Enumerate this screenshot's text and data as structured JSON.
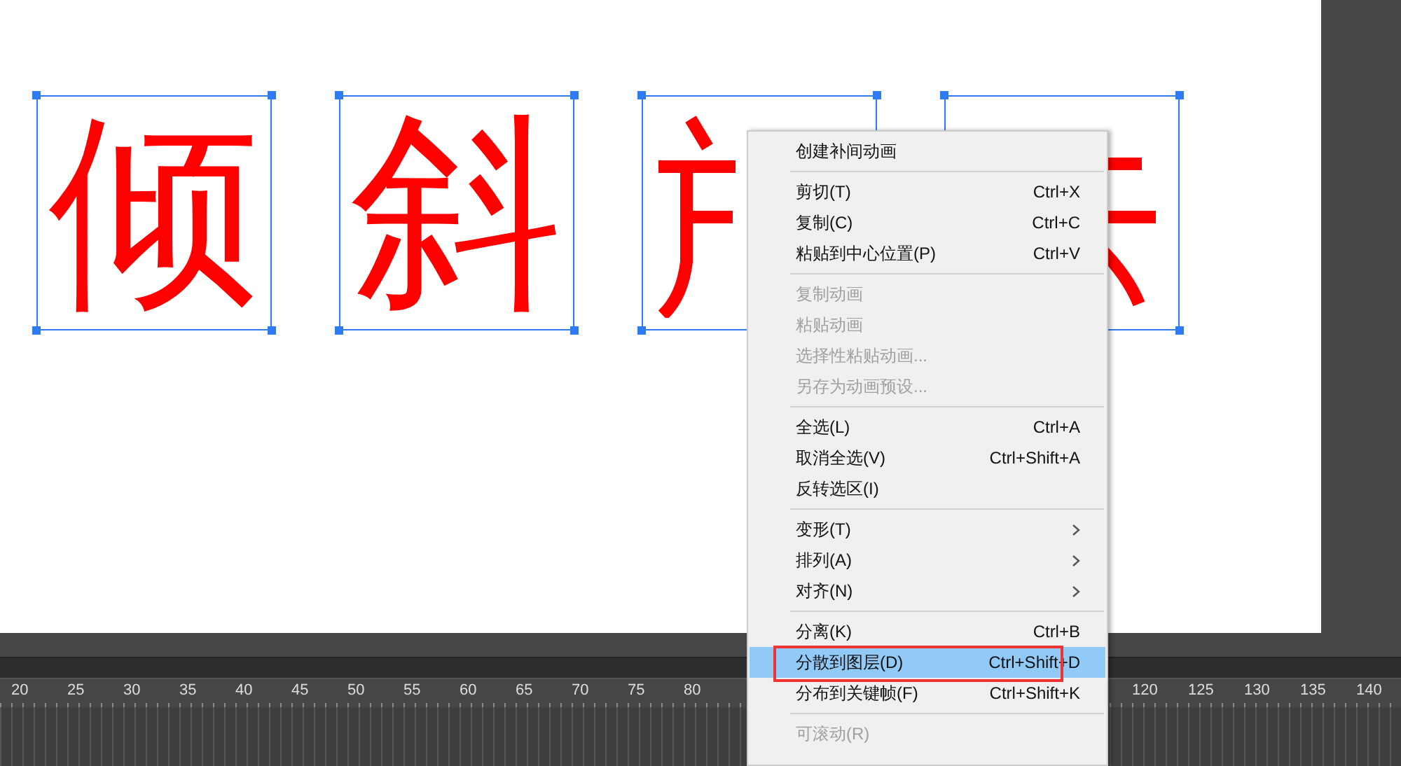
{
  "stage": {
    "characters": [
      {
        "kind": "glyph",
        "text": "倾"
      },
      {
        "kind": "glyph",
        "text": "斜"
      },
      {
        "kind": "leftfragment"
      },
      {
        "kind": "rightfragment"
      }
    ]
  },
  "timeline": {
    "frame_numbers": [
      "20",
      "25",
      "30",
      "35",
      "40",
      "45",
      "50",
      "55",
      "60",
      "65",
      "70",
      "75",
      "80",
      "120",
      "125",
      "130",
      "135",
      "140"
    ]
  },
  "context_menu": {
    "items": [
      {
        "kind": "item",
        "label": "创建补间动画",
        "disabled": false,
        "selected": false
      },
      {
        "kind": "separator"
      },
      {
        "kind": "item",
        "label": "剪切(T)",
        "shortcut": "Ctrl+X",
        "disabled": false,
        "selected": false
      },
      {
        "kind": "item",
        "label": "复制(C)",
        "shortcut": "Ctrl+C",
        "disabled": false,
        "selected": false
      },
      {
        "kind": "item",
        "label": "粘贴到中心位置(P)",
        "shortcut": "Ctrl+V",
        "disabled": false,
        "selected": false
      },
      {
        "kind": "separator"
      },
      {
        "kind": "item",
        "label": "复制动画",
        "disabled": true,
        "selected": false
      },
      {
        "kind": "item",
        "label": "粘贴动画",
        "disabled": true,
        "selected": false
      },
      {
        "kind": "item",
        "label": "选择性粘贴动画...",
        "disabled": true,
        "selected": false
      },
      {
        "kind": "item",
        "label": "另存为动画预设...",
        "disabled": true,
        "selected": false
      },
      {
        "kind": "separator"
      },
      {
        "kind": "item",
        "label": "全选(L)",
        "shortcut": "Ctrl+A",
        "disabled": false,
        "selected": false
      },
      {
        "kind": "item",
        "label": "取消全选(V)",
        "shortcut": "Ctrl+Shift+A",
        "disabled": false,
        "selected": false
      },
      {
        "kind": "item",
        "label": "反转选区(I)",
        "disabled": false,
        "selected": false
      },
      {
        "kind": "separator"
      },
      {
        "kind": "submenu",
        "label": "变形(T)",
        "disabled": false,
        "selected": false
      },
      {
        "kind": "submenu",
        "label": "排列(A)",
        "disabled": false,
        "selected": false
      },
      {
        "kind": "submenu",
        "label": "对齐(N)",
        "disabled": false,
        "selected": false
      },
      {
        "kind": "separator"
      },
      {
        "kind": "item",
        "label": "分离(K)",
        "shortcut": "Ctrl+B",
        "disabled": false,
        "selected": false
      },
      {
        "kind": "item",
        "label": "分散到图层(D)",
        "shortcut": "Ctrl+Shift+D",
        "disabled": false,
        "selected": true,
        "annotated": true
      },
      {
        "kind": "item",
        "label": "分布到关键帧(F)",
        "shortcut": "Ctrl+Shift+K",
        "disabled": false,
        "selected": false
      },
      {
        "kind": "separator"
      },
      {
        "kind": "item",
        "label": "可滚动(R)",
        "disabled": true,
        "selected": false
      }
    ]
  }
}
